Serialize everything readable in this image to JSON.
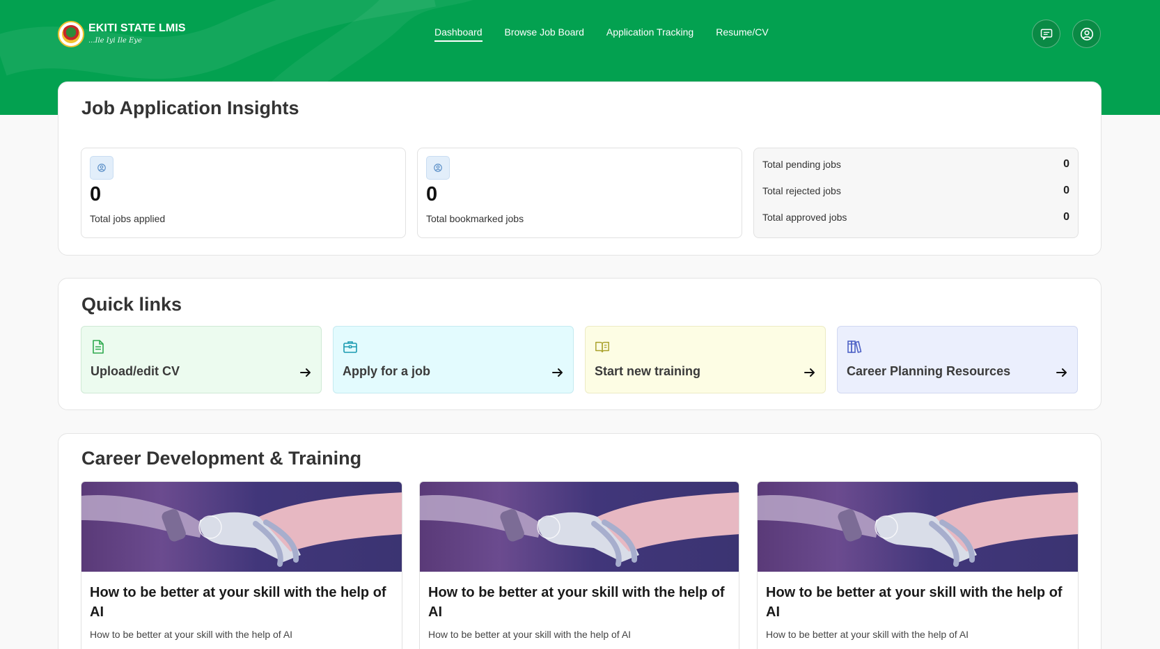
{
  "brand": {
    "title": "EKITI STATE LMIS",
    "slogan": "...Ile Iyi Ile Eye",
    "logo": "ekiti-state-seal"
  },
  "nav": {
    "items": [
      {
        "label": "Dashboard",
        "active": true
      },
      {
        "label": "Browse Job Board",
        "active": false
      },
      {
        "label": "Application Tracking",
        "active": false
      },
      {
        "label": "Resume/CV",
        "active": false
      }
    ]
  },
  "header_actions": {
    "messages_icon": "message-square-icon",
    "profile_icon": "user-circle-icon"
  },
  "insights": {
    "title": "Job Application Insights",
    "applied": {
      "value": "0",
      "label": "Total jobs applied",
      "icon": "user-circle-icon"
    },
    "bookmarked": {
      "value": "0",
      "label": "Total bookmarked jobs",
      "icon": "user-circle-icon"
    },
    "breakdown": [
      {
        "label": "Total pending jobs",
        "value": "0"
      },
      {
        "label": "Total rejected jobs",
        "value": "0"
      },
      {
        "label": "Total approved jobs",
        "value": "0"
      }
    ]
  },
  "quick_links": {
    "title": "Quick links",
    "items": [
      {
        "label": "Upload/edit CV",
        "icon": "document-icon",
        "color": "#2faa4f"
      },
      {
        "label": "Apply for a job",
        "icon": "briefcase-icon",
        "color": "#1a9ab0"
      },
      {
        "label": "Start new training",
        "icon": "open-book-icon",
        "color": "#a9a12a"
      },
      {
        "label": "Career Planning Resources",
        "icon": "books-icon",
        "color": "#4f63c6"
      }
    ]
  },
  "career": {
    "title": "Career Development & Training",
    "courses": [
      {
        "title": "How to be better at your skill with the help of AI",
        "description": "How to be better at your skill with the help of AI",
        "image": "robot-human-handshake"
      },
      {
        "title": "How to be better at your skill with the help of AI",
        "description": "How to be better at your skill with the help of AI",
        "image": "robot-human-handshake"
      },
      {
        "title": "How to be better at your skill with the help of AI",
        "description": "How to be better at your skill with the help of AI",
        "image": "robot-human-handshake"
      }
    ]
  },
  "colors": {
    "brand_green": "#03a150",
    "page_bg": "#f9f9f9"
  }
}
